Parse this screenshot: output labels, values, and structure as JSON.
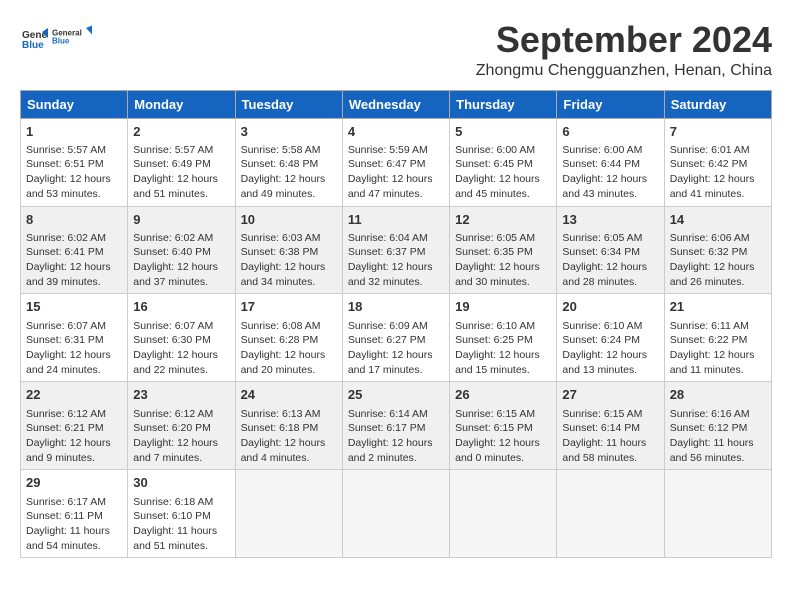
{
  "logo": {
    "general": "General",
    "blue": "Blue"
  },
  "header": {
    "month": "September 2024",
    "location": "Zhongmu Chengguanzhen, Henan, China"
  },
  "days_of_week": [
    "Sunday",
    "Monday",
    "Tuesday",
    "Wednesday",
    "Thursday",
    "Friday",
    "Saturday"
  ],
  "weeks": [
    [
      {
        "day": "1",
        "sunrise": "Sunrise: 5:57 AM",
        "sunset": "Sunset: 6:51 PM",
        "daylight": "Daylight: 12 hours and 53 minutes."
      },
      {
        "day": "2",
        "sunrise": "Sunrise: 5:57 AM",
        "sunset": "Sunset: 6:49 PM",
        "daylight": "Daylight: 12 hours and 51 minutes."
      },
      {
        "day": "3",
        "sunrise": "Sunrise: 5:58 AM",
        "sunset": "Sunset: 6:48 PM",
        "daylight": "Daylight: 12 hours and 49 minutes."
      },
      {
        "day": "4",
        "sunrise": "Sunrise: 5:59 AM",
        "sunset": "Sunset: 6:47 PM",
        "daylight": "Daylight: 12 hours and 47 minutes."
      },
      {
        "day": "5",
        "sunrise": "Sunrise: 6:00 AM",
        "sunset": "Sunset: 6:45 PM",
        "daylight": "Daylight: 12 hours and 45 minutes."
      },
      {
        "day": "6",
        "sunrise": "Sunrise: 6:00 AM",
        "sunset": "Sunset: 6:44 PM",
        "daylight": "Daylight: 12 hours and 43 minutes."
      },
      {
        "day": "7",
        "sunrise": "Sunrise: 6:01 AM",
        "sunset": "Sunset: 6:42 PM",
        "daylight": "Daylight: 12 hours and 41 minutes."
      }
    ],
    [
      {
        "day": "8",
        "sunrise": "Sunrise: 6:02 AM",
        "sunset": "Sunset: 6:41 PM",
        "daylight": "Daylight: 12 hours and 39 minutes."
      },
      {
        "day": "9",
        "sunrise": "Sunrise: 6:02 AM",
        "sunset": "Sunset: 6:40 PM",
        "daylight": "Daylight: 12 hours and 37 minutes."
      },
      {
        "day": "10",
        "sunrise": "Sunrise: 6:03 AM",
        "sunset": "Sunset: 6:38 PM",
        "daylight": "Daylight: 12 hours and 34 minutes."
      },
      {
        "day": "11",
        "sunrise": "Sunrise: 6:04 AM",
        "sunset": "Sunset: 6:37 PM",
        "daylight": "Daylight: 12 hours and 32 minutes."
      },
      {
        "day": "12",
        "sunrise": "Sunrise: 6:05 AM",
        "sunset": "Sunset: 6:35 PM",
        "daylight": "Daylight: 12 hours and 30 minutes."
      },
      {
        "day": "13",
        "sunrise": "Sunrise: 6:05 AM",
        "sunset": "Sunset: 6:34 PM",
        "daylight": "Daylight: 12 hours and 28 minutes."
      },
      {
        "day": "14",
        "sunrise": "Sunrise: 6:06 AM",
        "sunset": "Sunset: 6:32 PM",
        "daylight": "Daylight: 12 hours and 26 minutes."
      }
    ],
    [
      {
        "day": "15",
        "sunrise": "Sunrise: 6:07 AM",
        "sunset": "Sunset: 6:31 PM",
        "daylight": "Daylight: 12 hours and 24 minutes."
      },
      {
        "day": "16",
        "sunrise": "Sunrise: 6:07 AM",
        "sunset": "Sunset: 6:30 PM",
        "daylight": "Daylight: 12 hours and 22 minutes."
      },
      {
        "day": "17",
        "sunrise": "Sunrise: 6:08 AM",
        "sunset": "Sunset: 6:28 PM",
        "daylight": "Daylight: 12 hours and 20 minutes."
      },
      {
        "day": "18",
        "sunrise": "Sunrise: 6:09 AM",
        "sunset": "Sunset: 6:27 PM",
        "daylight": "Daylight: 12 hours and 17 minutes."
      },
      {
        "day": "19",
        "sunrise": "Sunrise: 6:10 AM",
        "sunset": "Sunset: 6:25 PM",
        "daylight": "Daylight: 12 hours and 15 minutes."
      },
      {
        "day": "20",
        "sunrise": "Sunrise: 6:10 AM",
        "sunset": "Sunset: 6:24 PM",
        "daylight": "Daylight: 12 hours and 13 minutes."
      },
      {
        "day": "21",
        "sunrise": "Sunrise: 6:11 AM",
        "sunset": "Sunset: 6:22 PM",
        "daylight": "Daylight: 12 hours and 11 minutes."
      }
    ],
    [
      {
        "day": "22",
        "sunrise": "Sunrise: 6:12 AM",
        "sunset": "Sunset: 6:21 PM",
        "daylight": "Daylight: 12 hours and 9 minutes."
      },
      {
        "day": "23",
        "sunrise": "Sunrise: 6:12 AM",
        "sunset": "Sunset: 6:20 PM",
        "daylight": "Daylight: 12 hours and 7 minutes."
      },
      {
        "day": "24",
        "sunrise": "Sunrise: 6:13 AM",
        "sunset": "Sunset: 6:18 PM",
        "daylight": "Daylight: 12 hours and 4 minutes."
      },
      {
        "day": "25",
        "sunrise": "Sunrise: 6:14 AM",
        "sunset": "Sunset: 6:17 PM",
        "daylight": "Daylight: 12 hours and 2 minutes."
      },
      {
        "day": "26",
        "sunrise": "Sunrise: 6:15 AM",
        "sunset": "Sunset: 6:15 PM",
        "daylight": "Daylight: 12 hours and 0 minutes."
      },
      {
        "day": "27",
        "sunrise": "Sunrise: 6:15 AM",
        "sunset": "Sunset: 6:14 PM",
        "daylight": "Daylight: 11 hours and 58 minutes."
      },
      {
        "day": "28",
        "sunrise": "Sunrise: 6:16 AM",
        "sunset": "Sunset: 6:12 PM",
        "daylight": "Daylight: 11 hours and 56 minutes."
      }
    ],
    [
      {
        "day": "29",
        "sunrise": "Sunrise: 6:17 AM",
        "sunset": "Sunset: 6:11 PM",
        "daylight": "Daylight: 11 hours and 54 minutes."
      },
      {
        "day": "30",
        "sunrise": "Sunrise: 6:18 AM",
        "sunset": "Sunset: 6:10 PM",
        "daylight": "Daylight: 11 hours and 51 minutes."
      },
      null,
      null,
      null,
      null,
      null
    ]
  ]
}
